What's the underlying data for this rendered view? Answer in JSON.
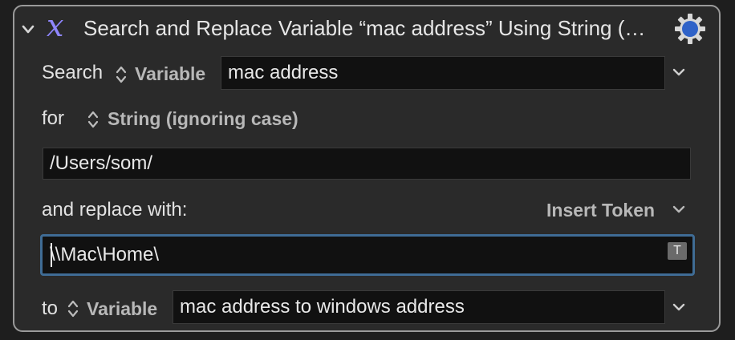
{
  "header": {
    "title": "Search and Replace Variable “mac address” Using String (…"
  },
  "rows": {
    "search_label": "Search",
    "search_type": "Variable",
    "search_value": "mac address",
    "for_label": "for",
    "for_type": "String (ignoring case)",
    "search_string": "/Users/som/",
    "replace_label": "and replace with:",
    "insert_token_label": "Insert Token",
    "replace_value": "\\\\Mac\\Home\\",
    "token_button": "T",
    "to_label": "to",
    "to_type": "Variable",
    "to_value": "mac address to windows address"
  },
  "colors": {
    "accent_focus": "#3f6c95",
    "icon_x": "#8f86ff",
    "gear": "#2f62c8"
  },
  "icons": [
    "chevron-down-icon",
    "variable-x-icon",
    "gear-icon",
    "updown-icon",
    "token-icon"
  ]
}
